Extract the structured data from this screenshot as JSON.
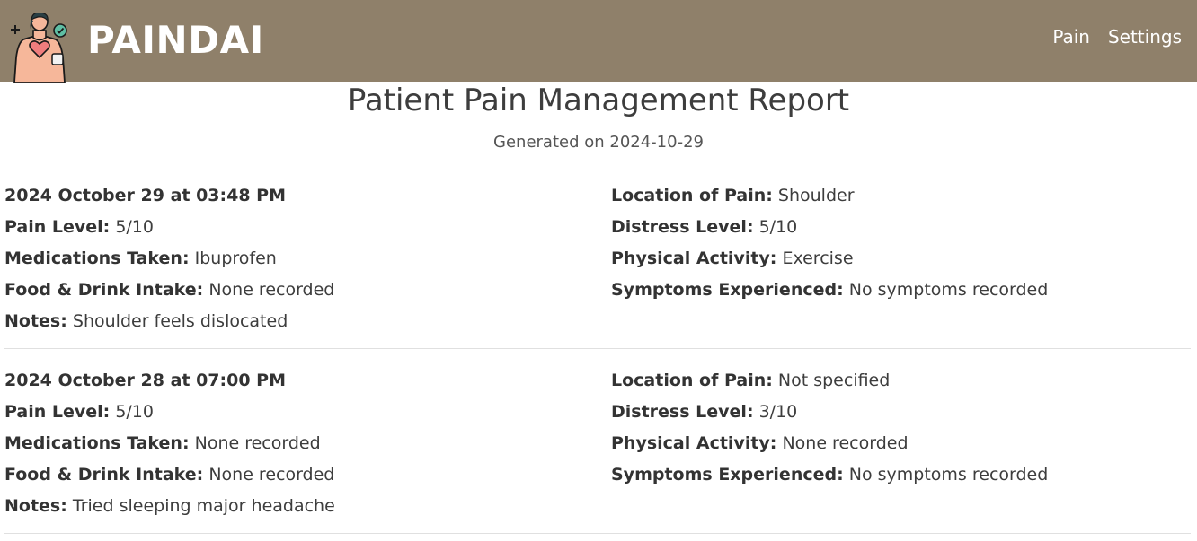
{
  "app": {
    "brand": "PAINDAI",
    "nav": {
      "pain": "Pain",
      "settings": "Settings"
    },
    "colors": {
      "navbar": "#8f806a",
      "text": "#3d3d3d"
    },
    "logo_icon": "patient-body-icon"
  },
  "report": {
    "title": "Patient Pain Management Report",
    "generated": "Generated on 2024-10-29"
  },
  "labels": {
    "pain_level": "Pain Level:",
    "medications": "Medications Taken:",
    "food": "Food & Drink Intake:",
    "notes": "Notes:",
    "location": "Location of Pain:",
    "distress": "Distress Level:",
    "activity": "Physical Activity:",
    "symptoms": "Symptoms Experienced:"
  },
  "entries": [
    {
      "datetime": "2024 October 29 at 03:48 PM",
      "pain_level": "5/10",
      "medications": "Ibuprofen",
      "food": "None recorded",
      "notes": "Shoulder feels dislocated",
      "location": "Shoulder",
      "distress": "5/10",
      "activity": "Exercise",
      "symptoms": "No symptoms recorded"
    },
    {
      "datetime": "2024 October 28 at 07:00 PM",
      "pain_level": "5/10",
      "medications": "None recorded",
      "food": "None recorded",
      "notes": "Tried sleeping major headache",
      "location": "Not specified",
      "distress": "3/10",
      "activity": "None recorded",
      "symptoms": "No symptoms recorded"
    }
  ]
}
